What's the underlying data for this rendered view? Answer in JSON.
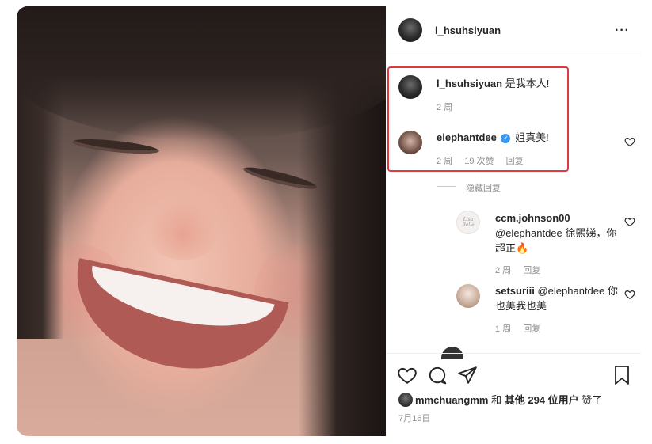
{
  "post": {
    "author": "l_hsuhsiyuan",
    "more_icon": "···"
  },
  "comments": [
    {
      "username": "l_hsuhsiyuan",
      "text": "是我本人!",
      "time": "2 周"
    },
    {
      "username": "elephantdee",
      "verified": true,
      "text": "姐真美!",
      "time": "2 周",
      "likes": "19 次赞",
      "reply": "回复"
    }
  ],
  "hide_replies": "隐藏回复",
  "replies": [
    {
      "username": "ccm.johnson00",
      "avatar_text": "Lisa Belle",
      "text": "@elephantdee 徐熙娣，你超正🔥",
      "text_line1": "@elephantdee 徐熙娣，你",
      "text_line2": "超正🔥",
      "time": "2 周",
      "reply": "回复"
    },
    {
      "username": "setsuriii",
      "text_line1": "@elephantdee 你",
      "text_line2": "也美我也美",
      "time": "1 周",
      "reply": "回复"
    }
  ],
  "likes_line": {
    "user": "mmchuangmm",
    "and": "和",
    "others": "其他 294 位用户",
    "suffix": "赞了"
  },
  "date": "7月16日",
  "colors": {
    "highlight_box": "#e0393e",
    "verified": "#3897f0",
    "meta_gray": "#8e8e8e"
  }
}
